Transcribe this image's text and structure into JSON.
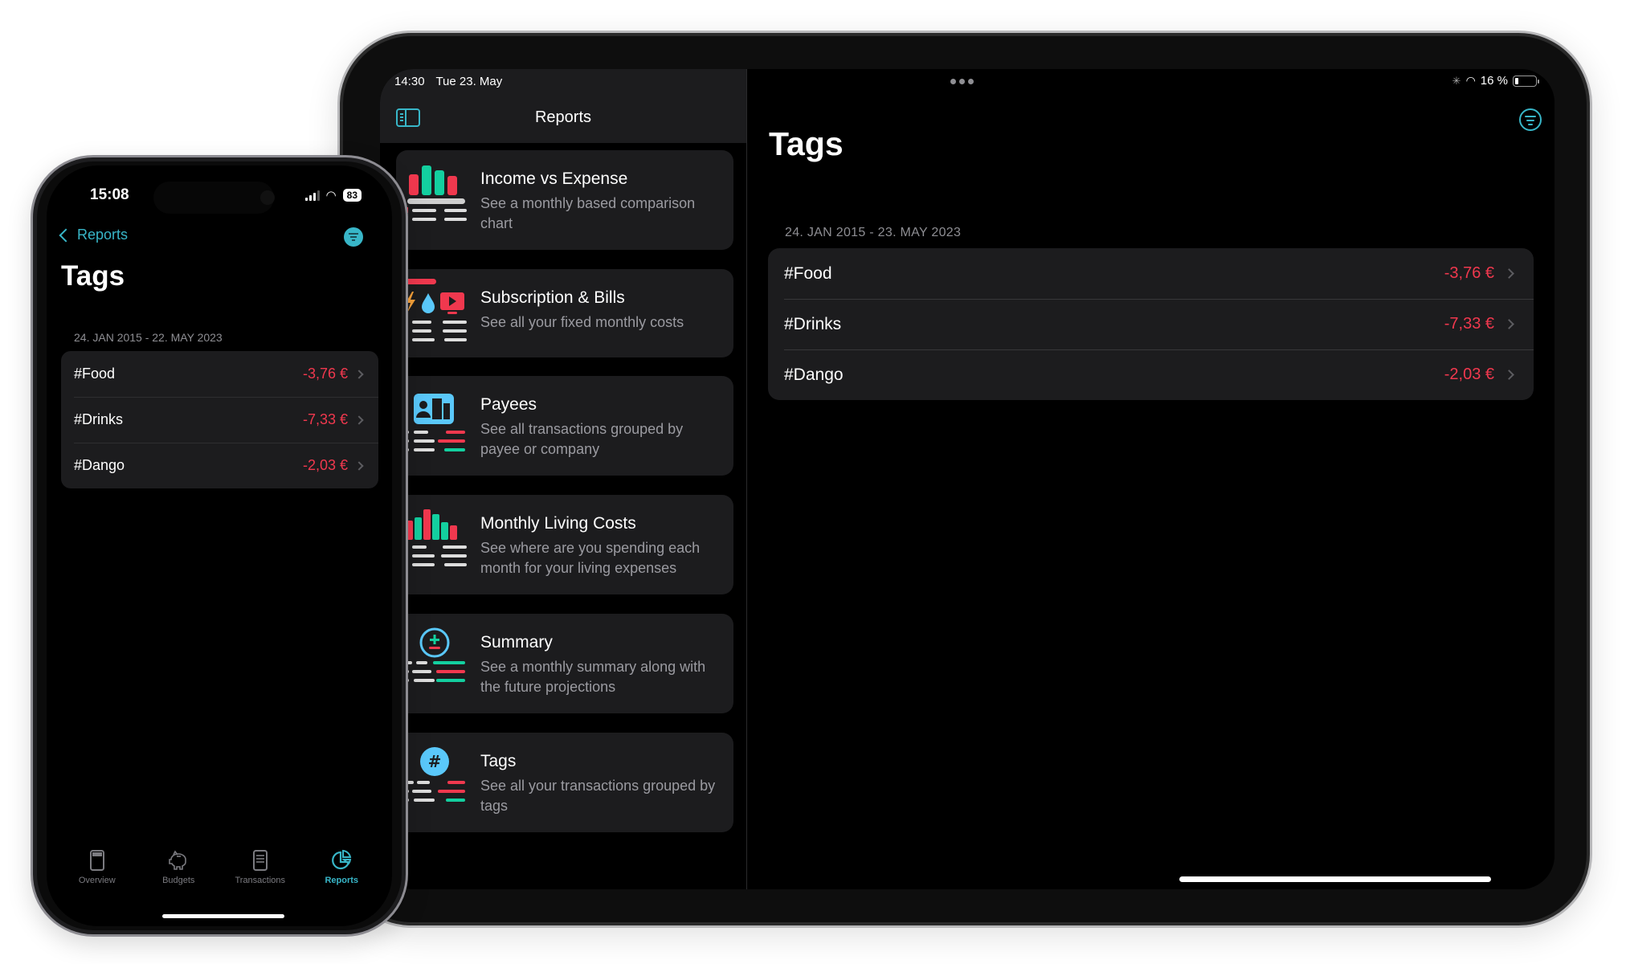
{
  "ipad": {
    "status": {
      "time": "14:30",
      "date": "Tue 23. May",
      "battery_percent": "16 %",
      "battery_level": 0.16
    },
    "sidebar": {
      "title": "Reports",
      "reports": [
        {
          "title": "Income vs Expense",
          "description": "See a monthly based comparison chart",
          "icon": "bar-chart-icon"
        },
        {
          "title": "Subscription & Bills",
          "description": "See all your fixed monthly costs",
          "icon": "bills-icon"
        },
        {
          "title": "Payees",
          "description": "See all transactions grouped by payee or company",
          "icon": "payees-icon"
        },
        {
          "title": "Monthly Living Costs",
          "description": "See where are you spending each month for your living expenses",
          "icon": "living-costs-icon"
        },
        {
          "title": "Summary",
          "description": "See a monthly summary along with the future projections",
          "icon": "summary-icon"
        },
        {
          "title": "Tags",
          "description": "See all your transactions grouped by tags",
          "icon": "hashtag-icon"
        }
      ]
    },
    "detail": {
      "title": "Tags",
      "date_range": "24. JAN 2015 - 23. MAY 2023",
      "tags": [
        {
          "name": "#Food",
          "amount": "-3,76 €"
        },
        {
          "name": "#Drinks",
          "amount": "-7,33 €"
        },
        {
          "name": "#Dango",
          "amount": "-2,03 €"
        }
      ]
    }
  },
  "iphone": {
    "status": {
      "time": "15:08",
      "battery": "83"
    },
    "nav": {
      "back_label": "Reports"
    },
    "title": "Tags",
    "date_range": "24. JAN 2015 - 22. MAY 2023",
    "tags": [
      {
        "name": "#Food",
        "amount": "-3,76 €"
      },
      {
        "name": "#Drinks",
        "amount": "-7,33 €"
      },
      {
        "name": "#Dango",
        "amount": "-2,03 €"
      }
    ],
    "tabs": [
      {
        "label": "Overview",
        "icon": "overview-icon",
        "active": false
      },
      {
        "label": "Budgets",
        "icon": "piggy-bank-icon",
        "active": false
      },
      {
        "label": "Transactions",
        "icon": "list-icon",
        "active": false
      },
      {
        "label": "Reports",
        "icon": "pie-chart-icon",
        "active": true
      }
    ]
  },
  "colors": {
    "accent": "#38b6c8",
    "negative": "#f0384e",
    "positive": "#13cf9f",
    "card": "#1c1c1e"
  }
}
